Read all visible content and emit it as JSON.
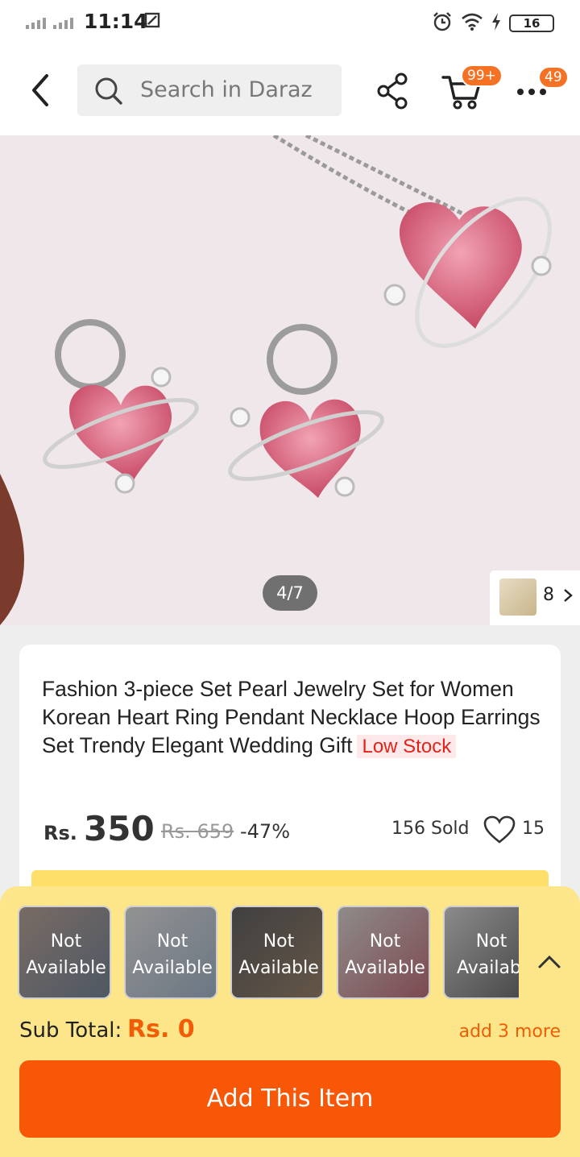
{
  "status_bar": {
    "time": "11:14",
    "extra_icon": "screenshot-icon",
    "battery_level": "16"
  },
  "header": {
    "search_placeholder": "Search in Daraz",
    "cart_badge": "99+",
    "more_badge": "49"
  },
  "gallery": {
    "counter": "4/7",
    "thumb_count": "8"
  },
  "product": {
    "title": "Fashion 3-piece Set Pearl Jewelry Set for Women Korean Heart Ring Pendant Necklace Hoop Earrings Set Trendy Elegant Wedding Gift",
    "stock_badge": "Low Stock",
    "currency": "Rs.",
    "price": "350",
    "old_price": "Rs. 659",
    "discount": "-47%",
    "sold": "156 Sold",
    "wishlist_count": "15"
  },
  "bundle": {
    "items": [
      {
        "status_line1": "Not",
        "status_line2": "Available"
      },
      {
        "status_line1": "Not",
        "status_line2": "Available"
      },
      {
        "status_line1": "Not",
        "status_line2": "Available"
      },
      {
        "status_line1": "Not",
        "status_line2": "Available"
      },
      {
        "status_line1": "Not",
        "status_line2": "Availabl"
      }
    ],
    "subtotal_label": "Sub Total:",
    "subtotal_value": "Rs. 0",
    "add_more": "add 3 more",
    "add_button": "Add This Item"
  },
  "colors": {
    "brand_orange": "#f75707",
    "panel_yellow": "#fde68a",
    "badge_orange": "#f57224"
  }
}
